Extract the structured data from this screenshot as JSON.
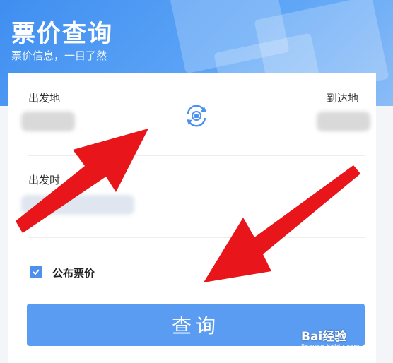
{
  "header": {
    "title": "票价查询",
    "subtitle": "票价信息，一目了然"
  },
  "form": {
    "departure_label": "出发地",
    "arrival_label": "到达地",
    "departure_date_label": "出发时",
    "swap_icon": "swap-stations-icon",
    "publish_fare_label": "公布票价",
    "publish_fare_checked": true,
    "query_button_label": "查询"
  },
  "watermark": {
    "main": "Bai经验",
    "sub": "jingyan.baidu.com"
  },
  "colors": {
    "primary": "#4d90ee",
    "button": "#5a9cf1",
    "arrow": "#e8151b"
  }
}
